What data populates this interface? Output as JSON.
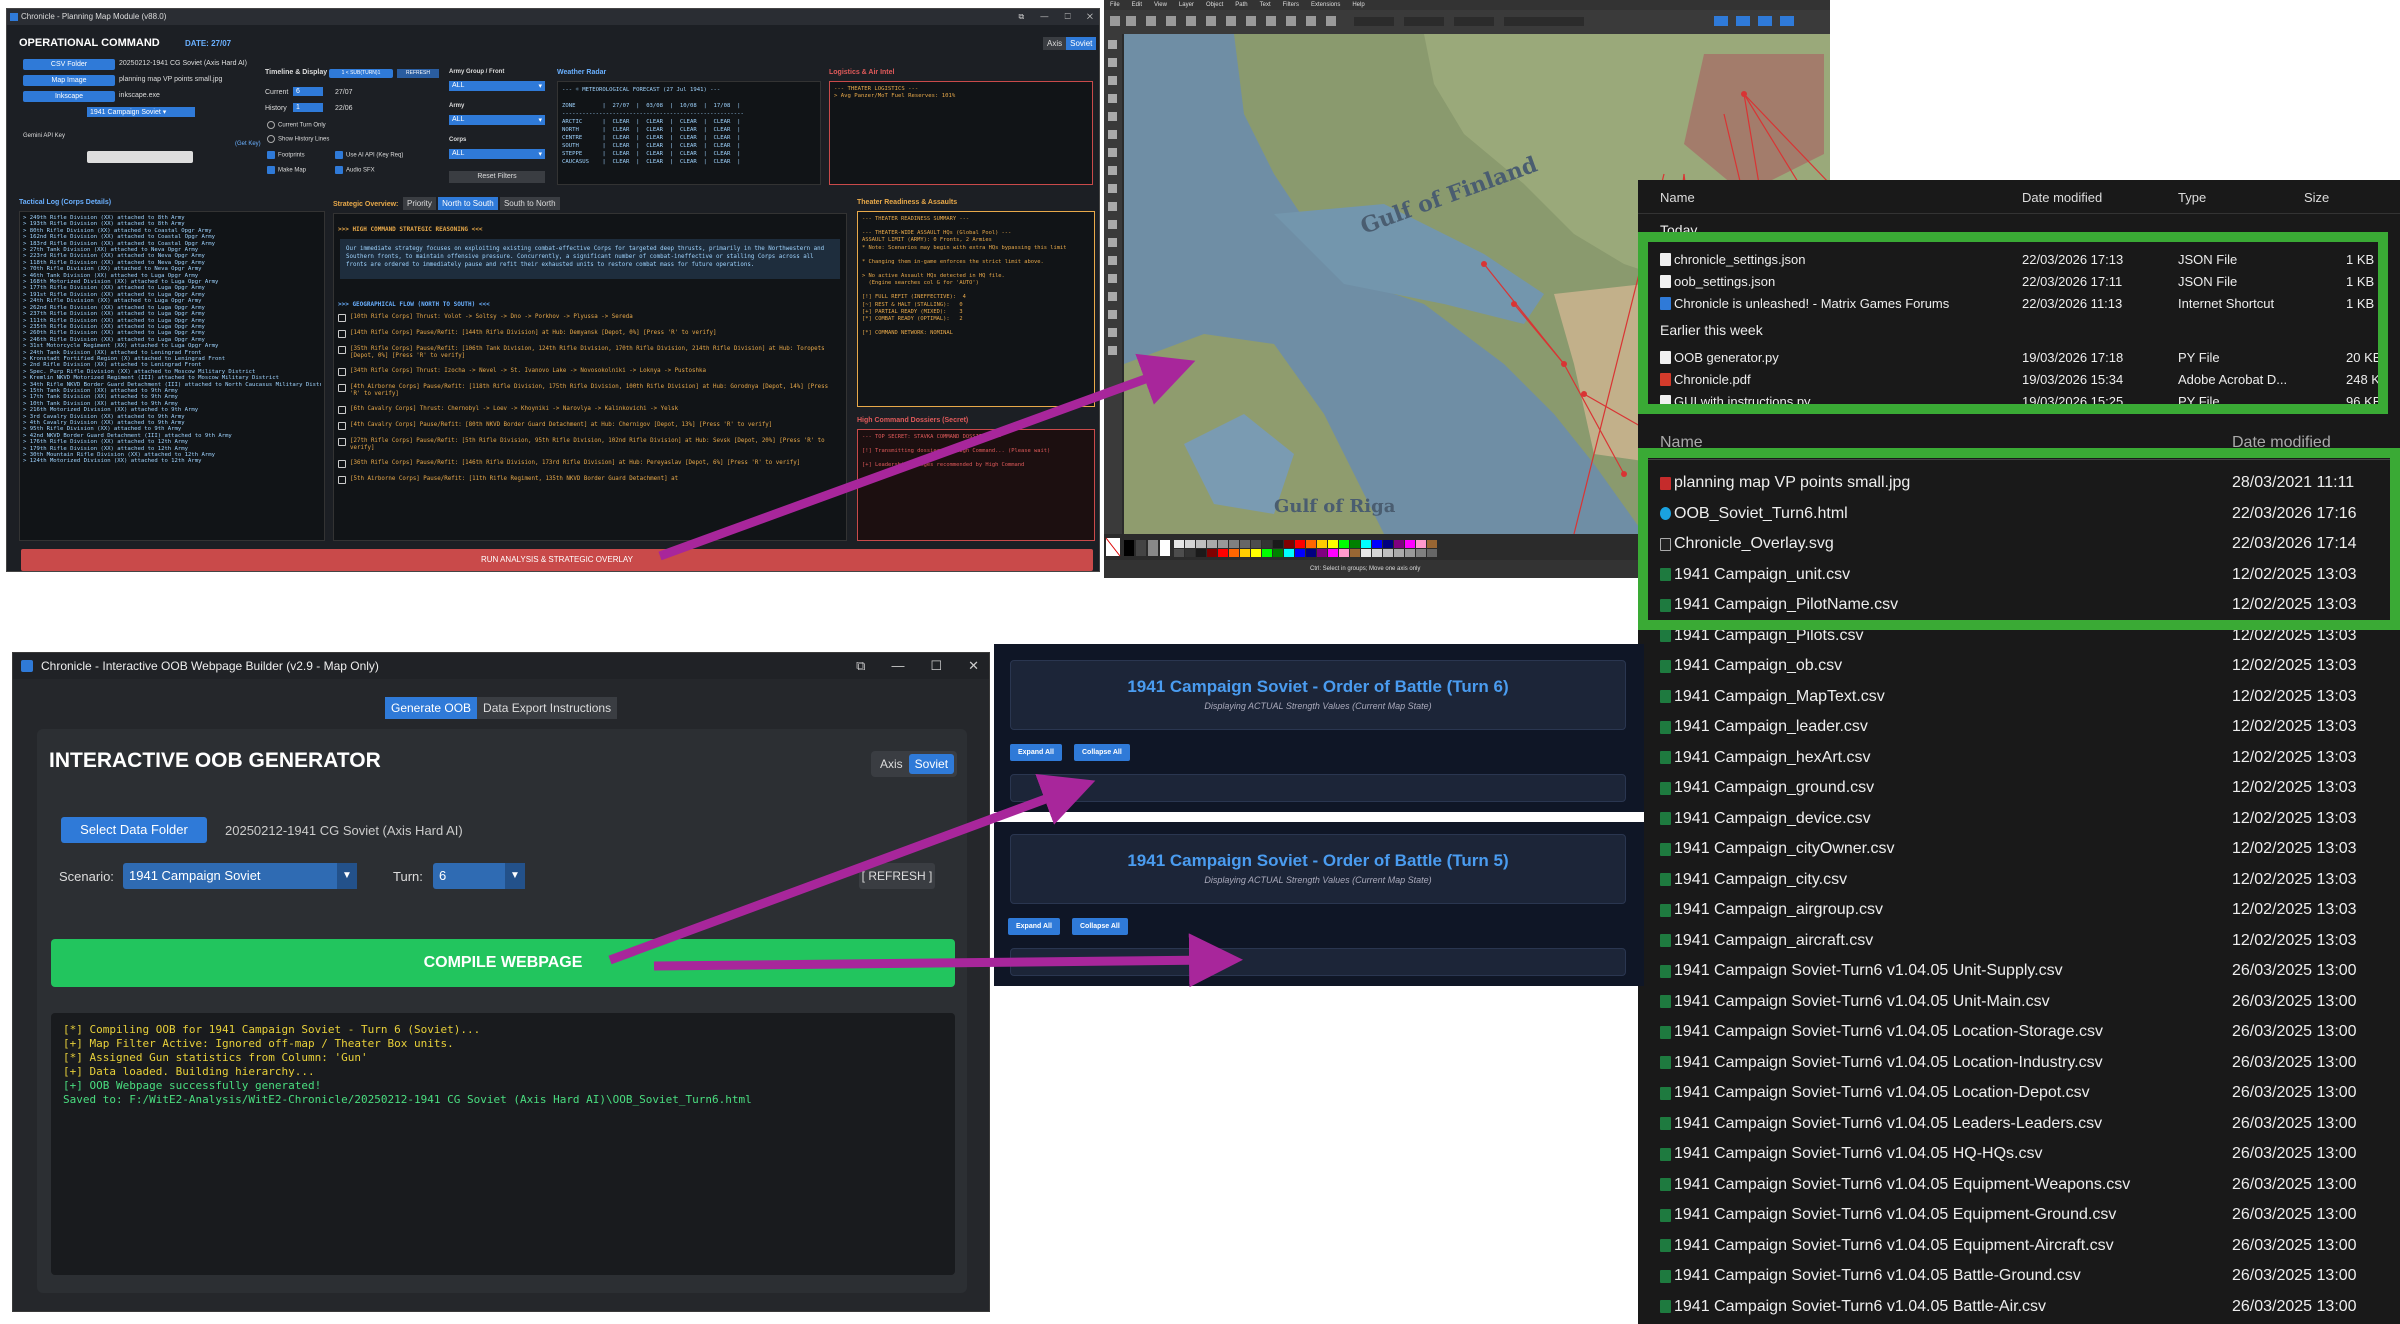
{
  "w1": {
    "title": "Chronicle - Planning Map Module (v88.0)",
    "header": "OPERATIONAL COMMAND",
    "date": "DATE: 27/07",
    "side_toggle": [
      "Axis",
      "Soviet"
    ],
    "csv_folder_btn": "CSV Folder",
    "csv_folder_val": "20250212-1941 CG Soviet (Axis Hard AI)",
    "map_image_btn": "Map Image",
    "map_image_val": "planning map VP points small.jpg",
    "inkscape_btn": "Inkscape",
    "inkscape_val": "inkscape.exe",
    "scenario_val": "1941 Campaign Soviet",
    "gemini_label": "Gemini API Key",
    "get_key": "(Get Key)",
    "timeline_hdr": "Timeline & Display",
    "timeline_btn1": "1 < SUB(TURN)1",
    "timeline_btn2": "REFRESH",
    "current_lbl": "Current",
    "current_val": "6",
    "current_date": "27/07",
    "history_lbl": "History",
    "history_val": "1",
    "history_date": "22/06",
    "radio1": "Current Turn Only",
    "radio2": "Show History Lines",
    "chk_footprints": "Footprints",
    "chk_make_map": "Make Map",
    "chk_ai_api": "Use AI API (Key Req)",
    "chk_audio": "Audio SFX",
    "army_group_hdr": "Army Group / Front",
    "army_hdr": "Army",
    "corps_hdr": "Corps",
    "all": "ALL",
    "reset_filters": "Reset Filters",
    "weather_hdr": "Weather Radar",
    "weather_lines": [
      "--- ☼ METEOROLOGICAL FORECAST (27 Jul 1941) ---",
      "",
      "ZONE        |  27/07  |  03/08  |  10/08  |  17/08  |",
      "------------------------------------------------------",
      "ARCTIC      |  CLEAR  |  CLEAR  |  CLEAR  |  CLEAR  |",
      "NORTH       |  CLEAR  |  CLEAR  |  CLEAR  |  CLEAR  |",
      "CENTRE      |  CLEAR  |  CLEAR  |  CLEAR  |  CLEAR  |",
      "SOUTH       |  CLEAR  |  CLEAR  |  CLEAR  |  CLEAR  |",
      "STEPPE      |  CLEAR  |  CLEAR  |  CLEAR  |  CLEAR  |",
      "CAUCASUS    |  CLEAR  |  CLEAR  |  CLEAR  |  CLEAR  |"
    ],
    "logistics_hdr": "Logistics & Air Intel",
    "logistics_lines": [
      "--- THEATER LOGISTICS ---",
      "> Avg Panzer/MoT Fuel Reserves: 101%"
    ],
    "tactical_hdr": "Tactical Log (Corps Details)",
    "tactical_lines": [
      "> 249th Rifle Division (XX) attached to 8th Army",
      "> 193th Rifle Division (XX) attached to 8th Army",
      "> 80th Rifle Division (XX) attached to Coastal Opgr Army",
      "> 162nd Rifle Division (XX) attached to Coastal Opgr Army",
      "> 183rd Rifle Division (XX) attached to Coastal Opgr Army",
      "> 27th Tank Division (XX) attached to Neva Opgr Army",
      "> 223rd Rifle Division (XX) attached to Neva Opgr Army",
      "> 118th Rifle Division (XX) attached to Neva Opgr Army",
      "> 70th Rifle Division (XX) attached to Neva Opgr Army",
      "> 46th Tank Division (XX) attached to Luga Opgr Army",
      "> 168th Motorized Division (XX) attached to Luga Opgr Army",
      "> 177th Rifle Division (XX) attached to Luga Opgr Army",
      "> 191st Rifle Division (XX) attached to Luga Opgr Army",
      "> 24th Rifle Division (XX) attached to Luga Opgr Army",
      "> 262nd Rifle Division (XX) attached to Luga Opgr Army",
      "> 237th Rifle Division (XX) attached to Luga Opgr Army",
      "> 111th Rifle Division (XX) attached to Luga Opgr Army",
      "> 235th Rifle Division (XX) attached to Luga Opgr Army",
      "> 260th Rifle Division (XX) attached to Luga Opgr Army",
      "> 246th Rifle Division (XX) attached to Luga Opgr Army",
      "> 31st Motorcycle Regiment (XX) attached to Luga Opgr Army",
      "> 24th Tank Division (XX) attached to Leningrad Front",
      "> Kronstadt Fortified Region (X) attached to Leningrad Front",
      "> 2nd Rifle Division (XX) attached to Leningrad Front",
      "> Spec. Purp Rifle Division (XX) attached to Moscow Military District",
      "> Kremlin NKVD Motorized Regiment (III) attached to Moscow Military District",
      "> 34th Rifle NKVD Border Guard Detachment (III) attached to North Caucasus Military District",
      "> 15th Tank Division (XX) attached to 9th Army",
      "> 17th Tank Division (XX) attached to 9th Army",
      "> 10th Tank Division (XX) attached to 9th Army",
      "> 216th Motorized Division (XX) attached to 9th Army",
      "> 3rd Cavalry Division (XX) attached to 9th Army",
      "> 4th Cavalry Division (XX) attached to 9th Army",
      "> 95th Rifle Division (XX) attached to 9th Army",
      "> 42nd NKVD Border Guard Detachment (III) attached to 9th Army",
      "> 176th Rifle Division (XX) attached to 12th Army",
      "> 179th Rifle Division (XX) attached to 12th Army",
      "> 30th Mountain Rifle Division (XX) attached to 12th Army",
      "> 124th Motorized Division (XX) attached to 12th Army"
    ],
    "strategic_hdr": "Strategic Overview:",
    "strategic_tabs": [
      "Priority",
      "North to South",
      "South to North"
    ],
    "hc_title": ">>> HIGH COMMAND STRATEGIC REASONING <<<",
    "hc_text": "Our immediate strategy focuses on exploiting existing combat-effective Corps for targeted deep thrusts, primarily in the Northwestern and Southern fronts, to maintain offensive pressure. Concurrently, a significant number of combat-ineffective or stalling Corps across all fronts are ordered to immediately pause and refit their exhausted units to restore combat mass for future operations.",
    "geo_title": ">>> GEOGRAPHICAL FLOW (NORTH TO SOUTH) <<<",
    "flow_items": [
      "[10th Rifle Corps] Thrust: Volot -> Soltsy -> Dno -> Porkhov -> Plyussa -> Sereda",
      "[14th Rifle Corps] Pause/Refit: [144th Rifle Division] at Hub: Demyansk [Depot, 0%] [Press 'R' to verify]",
      "[35th Rifle Corps] Pause/Refit: [106th Tank Division, 124th Rifle Division, 170th Rifle Division, 214th Rifle Division] at Hub: Toropets [Depot, 0%] [Press 'R' to verify]",
      "[34th Rifle Corps] Thrust: Izocha -> Nevel -> St. Ivanovo Lake -> Novosokolniki -> Loknya -> Pustoshka",
      "[4th Airborne Corps] Pause/Refit: [118th Rifle Division, 175th Rifle Division, 100th Rifle Division] at Hub: Gorodnya [Depot, 14%] [Press 'R' to verify]",
      "[6th Cavalry Corps] Thrust: Chernobyl -> Loev -> Khoyniki -> Narovlya -> Kalinkovichi -> Yelsk",
      "[4th Cavalry Corps] Pause/Refit: [80th NKVD Border Guard Detachment] at Hub: Chernigov [Depot, 13%] [Press 'R' to verify]",
      "[27th Rifle Corps] Pause/Refit: [5th Rifle Division, 95th Rifle Division, 102nd Rifle Division] at Hub: Sevsk [Depot, 20%] [Press 'R' to verify]",
      "[36th Rifle Corps] Pause/Refit: [146th Rifle Division, 173rd Rifle Division] at Hub: Pereyaslav [Depot, 6%] [Press 'R' to verify]",
      "[5th Airborne Corps] Pause/Refit: [11th Rifle Regiment, 135th NKVD Border Guard Detachment] at"
    ],
    "readiness_hdr": "Theater Readiness & Assaults",
    "readiness_lines": [
      "--- THEATER READINESS SUMMARY ---",
      "",
      "--- THEATER-WIDE ASSAULT HQs (Global Pool) ---",
      "ASSAULT LIMIT (ARMY): 0 Fronts, 2 Armies",
      "* Note: Scenarios may begin with extra HQs bypassing this limit",
      "",
      "* Changing them in-game enforces the strict limit above.",
      "",
      "> No active Assault HQs detected in HQ file.",
      "  (Engine searches col G for 'AUTO')",
      "",
      "[!] FULL REFIT (INEFFECTIVE):  4",
      "[~] REST & HALT (STALLING):   0",
      "[+] PARTIAL READY (MIXED):    3",
      "[*] COMBAT READY (OPTIMAL):   2",
      "",
      "[*] COMMAND NETWORK: NOMINAL"
    ],
    "dossiers_hdr": "High Command Dossiers (Secret)",
    "dossier_lines": [
      "--- TOP SECRET: STAVKA COMMAND DOSSIERS ---",
      "",
      "[!] Transmitting dossiers to High Command... (Please wait)",
      "",
      "[+] Leadership changes recommended by High Command"
    ],
    "run_btn": "RUN ANALYSIS & STRATEGIC OVERLAY"
  },
  "w2": {
    "menu": [
      "File",
      "Edit",
      "View",
      "Layer",
      "Object",
      "Path",
      "Text",
      "Filters",
      "Extensions",
      "Help"
    ],
    "map_label1": "Gulf of Finland",
    "map_label2": "Gulf of Riga",
    "status_hint": "Ctrl: Select in groups; Move one axis only"
  },
  "w3": {
    "cols": [
      "Name",
      "Date modified",
      "Type",
      "Size"
    ],
    "group_today": "Today",
    "group_earlier": "Earlier this week",
    "top_files": [
      {
        "name": "chronicle_settings.json",
        "date": "22/03/2026 17:13",
        "type": "JSON File",
        "size": "1 KB",
        "ic": "json"
      },
      {
        "name": "oob_settings.json",
        "date": "22/03/2026 17:11",
        "type": "JSON File",
        "size": "1 KB",
        "ic": "json"
      },
      {
        "name": "Chronicle is unleashed! - Matrix Games Forums",
        "date": "22/03/2026 11:13",
        "type": "Internet Shortcut",
        "size": "1 KB",
        "ic": "url"
      }
    ],
    "week_files": [
      {
        "name": "OOB generator.py",
        "date": "19/03/2026 17:18",
        "type": "PY File",
        "size": "20 KB",
        "ic": "json"
      },
      {
        "name": "Chronicle.pdf",
        "date": "19/03/2026 15:34",
        "type": "Adobe Acrobat D...",
        "size": "248 KB",
        "ic": "pdf"
      },
      {
        "name": "GUI with instructions.py",
        "date": "19/03/2026 15:25",
        "type": "PY File",
        "size": "96 KB",
        "ic": "json"
      }
    ],
    "cols2": [
      "Name",
      "Date modified"
    ],
    "big_files": [
      {
        "name": "planning map VP points small.jpg",
        "date": "28/03/2021 11:11",
        "ic": "jpg"
      },
      {
        "name": "OOB_Soviet_Turn6.html",
        "date": "22/03/2026 17:16",
        "ic": "html"
      },
      {
        "name": "Chronicle_Overlay.svg",
        "date": "22/03/2026 17:14",
        "ic": "svg"
      },
      {
        "name": "1941 Campaign_unit.csv",
        "date": "12/02/2025 13:03",
        "ic": "csv"
      },
      {
        "name": "1941 Campaign_PilotName.csv",
        "date": "12/02/2025 13:03",
        "ic": "csv"
      },
      {
        "name": "1941 Campaign_Pilots.csv",
        "date": "12/02/2025 13:03",
        "ic": "csv"
      },
      {
        "name": "1941 Campaign_ob.csv",
        "date": "12/02/2025 13:03",
        "ic": "csv"
      },
      {
        "name": "1941 Campaign_MapText.csv",
        "date": "12/02/2025 13:03",
        "ic": "csv"
      },
      {
        "name": "1941 Campaign_leader.csv",
        "date": "12/02/2025 13:03",
        "ic": "csv"
      },
      {
        "name": "1941 Campaign_hexArt.csv",
        "date": "12/02/2025 13:03",
        "ic": "csv"
      },
      {
        "name": "1941 Campaign_ground.csv",
        "date": "12/02/2025 13:03",
        "ic": "csv"
      },
      {
        "name": "1941 Campaign_device.csv",
        "date": "12/02/2025 13:03",
        "ic": "csv"
      },
      {
        "name": "1941 Campaign_cityOwner.csv",
        "date": "12/02/2025 13:03",
        "ic": "csv"
      },
      {
        "name": "1941 Campaign_city.csv",
        "date": "12/02/2025 13:03",
        "ic": "csv"
      },
      {
        "name": "1941 Campaign_airgroup.csv",
        "date": "12/02/2025 13:03",
        "ic": "csv"
      },
      {
        "name": "1941 Campaign_aircraft.csv",
        "date": "12/02/2025 13:03",
        "ic": "csv"
      },
      {
        "name": "1941 Campaign Soviet-Turn6 v1.04.05 Unit-Supply.csv",
        "date": "26/03/2025 13:00",
        "ic": "csv"
      },
      {
        "name": "1941 Campaign Soviet-Turn6 v1.04.05 Unit-Main.csv",
        "date": "26/03/2025 13:00",
        "ic": "csv"
      },
      {
        "name": "1941 Campaign Soviet-Turn6 v1.04.05 Location-Storage.csv",
        "date": "26/03/2025 13:00",
        "ic": "csv"
      },
      {
        "name": "1941 Campaign Soviet-Turn6 v1.04.05 Location-Industry.csv",
        "date": "26/03/2025 13:00",
        "ic": "csv"
      },
      {
        "name": "1941 Campaign Soviet-Turn6 v1.04.05 Location-Depot.csv",
        "date": "26/03/2025 13:00",
        "ic": "csv"
      },
      {
        "name": "1941 Campaign Soviet-Turn6 v1.04.05 Leaders-Leaders.csv",
        "date": "26/03/2025 13:00",
        "ic": "csv"
      },
      {
        "name": "1941 Campaign Soviet-Turn6 v1.04.05 HQ-HQs.csv",
        "date": "26/03/2025 13:00",
        "ic": "csv"
      },
      {
        "name": "1941 Campaign Soviet-Turn6 v1.04.05 Equipment-Weapons.csv",
        "date": "26/03/2025 13:00",
        "ic": "csv"
      },
      {
        "name": "1941 Campaign Soviet-Turn6 v1.04.05 Equipment-Ground.csv",
        "date": "26/03/2025 13:00",
        "ic": "csv"
      },
      {
        "name": "1941 Campaign Soviet-Turn6 v1.04.05 Equipment-Aircraft.csv",
        "date": "26/03/2025 13:00",
        "ic": "csv"
      },
      {
        "name": "1941 Campaign Soviet-Turn6 v1.04.05 Battle-Ground.csv",
        "date": "26/03/2025 13:00",
        "ic": "csv"
      },
      {
        "name": "1941 Campaign Soviet-Turn6 v1.04.05 Battle-Air.csv",
        "date": "26/03/2025 13:00",
        "ic": "csv"
      }
    ]
  },
  "w4": {
    "title": "Chronicle - Interactive OOB Webpage Builder (v2.9 - Map Only)",
    "tabs": [
      "Generate OOB",
      "Data Export Instructions"
    ],
    "heading": "INTERACTIVE OOB GENERATOR",
    "side_toggle": [
      "Axis",
      "Soviet"
    ],
    "select_folder": "Select Data Folder",
    "folder_val": "20250212-1941 CG Soviet (Axis Hard AI)",
    "scenario_lbl": "Scenario:",
    "scenario_val": "1941 Campaign Soviet",
    "turn_lbl": "Turn:",
    "turn_val": "6",
    "refresh": "[ REFRESH ]",
    "compile": "COMPILE WEBPAGE",
    "log": [
      {
        "t": "[*] Compiling OOB for 1941 Campaign Soviet - Turn 6 (Soviet)...",
        "c": "y"
      },
      {
        "t": "[+] Map Filter Active: Ignored off-map / Theater Box units.",
        "c": "y"
      },
      {
        "t": "[*] Assigned Gun statistics from Column: 'Gun'",
        "c": "y"
      },
      {
        "t": "[+] Data loaded. Building hierarchy...",
        "c": "y"
      },
      {
        "t": "[+] OOB Webpage successfully generated!",
        "c": "g"
      },
      {
        "t": "Saved to: F:/WitE2-Analysis/WitE2-Chronicle/20250212-1941 CG Soviet (Axis Hard AI)\\OOB_Soviet_Turn6.html",
        "c": "g"
      }
    ]
  },
  "w5": {
    "title6": "1941 Campaign Soviet - Order of Battle (Turn 6)",
    "sub6": "Displaying ACTUAL Strength Values (Current Map State)",
    "title5": "1941 Campaign Soviet - Order of Battle (Turn 5)",
    "sub5": "Displaying ACTUAL Strength Values (Current Map State)",
    "expand": "Expand All",
    "collapse": "Collapse All"
  },
  "colors": {
    "accent": "#2f7ad8",
    "compile_green": "#22c55e",
    "run_red": "#c94a4a",
    "highlight_green": "#3aaa35",
    "arrow_purple": "#a8269b"
  }
}
